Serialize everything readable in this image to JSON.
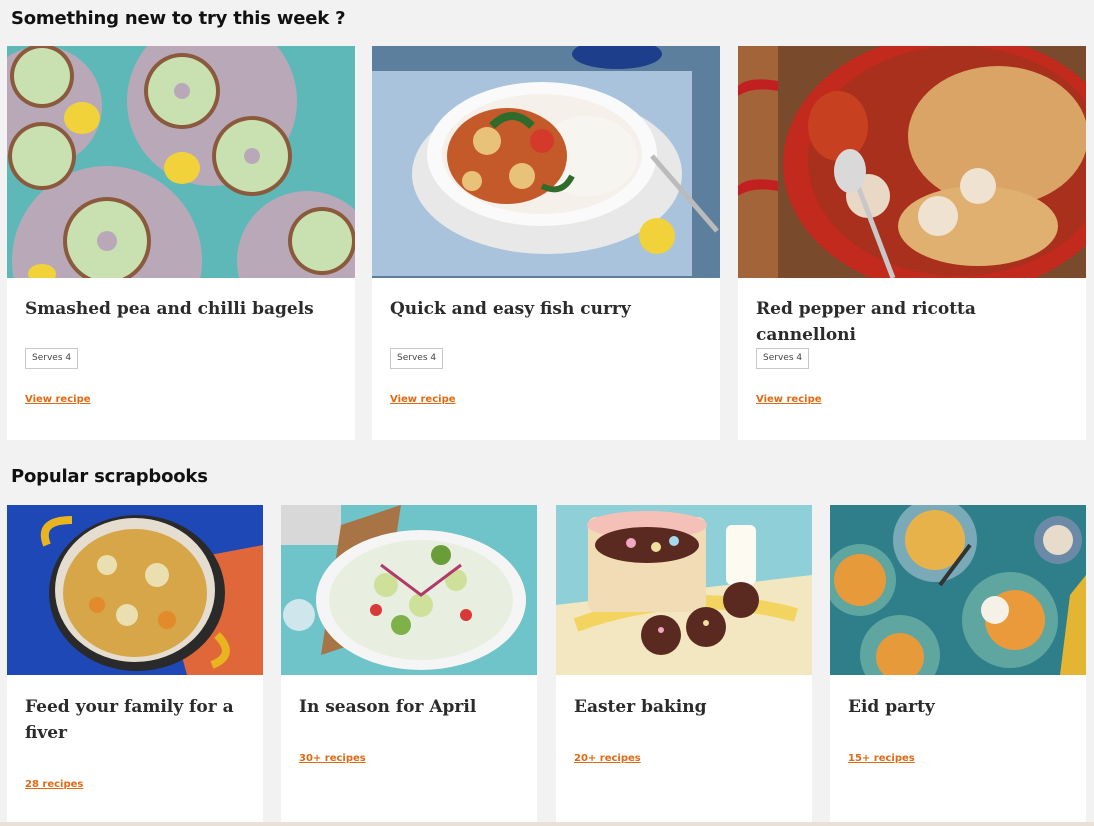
{
  "sections": {
    "new_this_week": "Something new to try this week ?",
    "popular_scrapbooks": "Popular scrapbooks"
  },
  "recipes": [
    {
      "name": "Smashed pea and chilli bagels",
      "serves": "Serves 4",
      "link": "View recipe"
    },
    {
      "name": "Quick and easy fish curry",
      "serves": "Serves 4",
      "link": "View recipe"
    },
    {
      "name": "Red pepper and ricotta cannelloni",
      "serves": "Serves 4",
      "link": "View recipe"
    }
  ],
  "scrapbooks": [
    {
      "name": "Feed your family for a fiver",
      "count": "28 recipes"
    },
    {
      "name": "In season for April",
      "count": "30+ recipes"
    },
    {
      "name": "Easter baking",
      "count": "20+ recipes"
    },
    {
      "name": "Eid party",
      "count": "15+ recipes"
    }
  ],
  "colors": {
    "accent": "#e06a14",
    "background": "#f2f2f2",
    "card": "#ffffff"
  }
}
